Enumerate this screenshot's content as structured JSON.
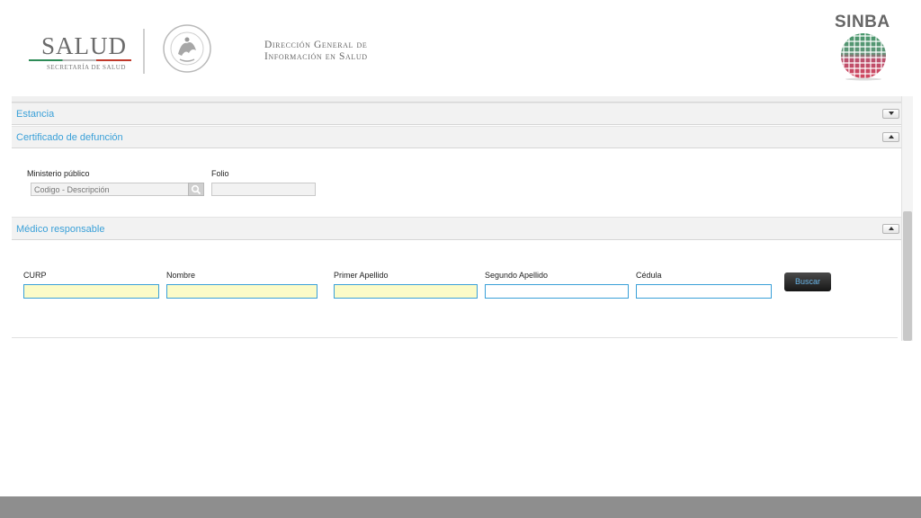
{
  "header": {
    "salud_word": "SALUD",
    "salud_sub": "SECRETARÍA DE SALUD",
    "dgis_line1": "Dirección General de",
    "dgis_line2": "Información en Salud",
    "sinba": "SINBA"
  },
  "sections": {
    "estancia": {
      "title": "Estancia"
    },
    "certificado": {
      "title": "Certificado de defunción",
      "ministerio_label": "Ministerio público",
      "ministerio_placeholder": "Codigo - Descripción",
      "folio_label": "Folio",
      "folio_value": ""
    },
    "medico": {
      "title": "Médico responsable",
      "curp_label": "CURP",
      "nombre_label": "Nombre",
      "primer_label": "Primer Apellido",
      "segundo_label": "Segundo Apellido",
      "cedula_label": "Cédula",
      "buscar_label": "Buscar"
    }
  },
  "colors": {
    "accent": "#3aa0d8",
    "required_field": "#fbfbc8",
    "footer": "#8e8e8e"
  }
}
